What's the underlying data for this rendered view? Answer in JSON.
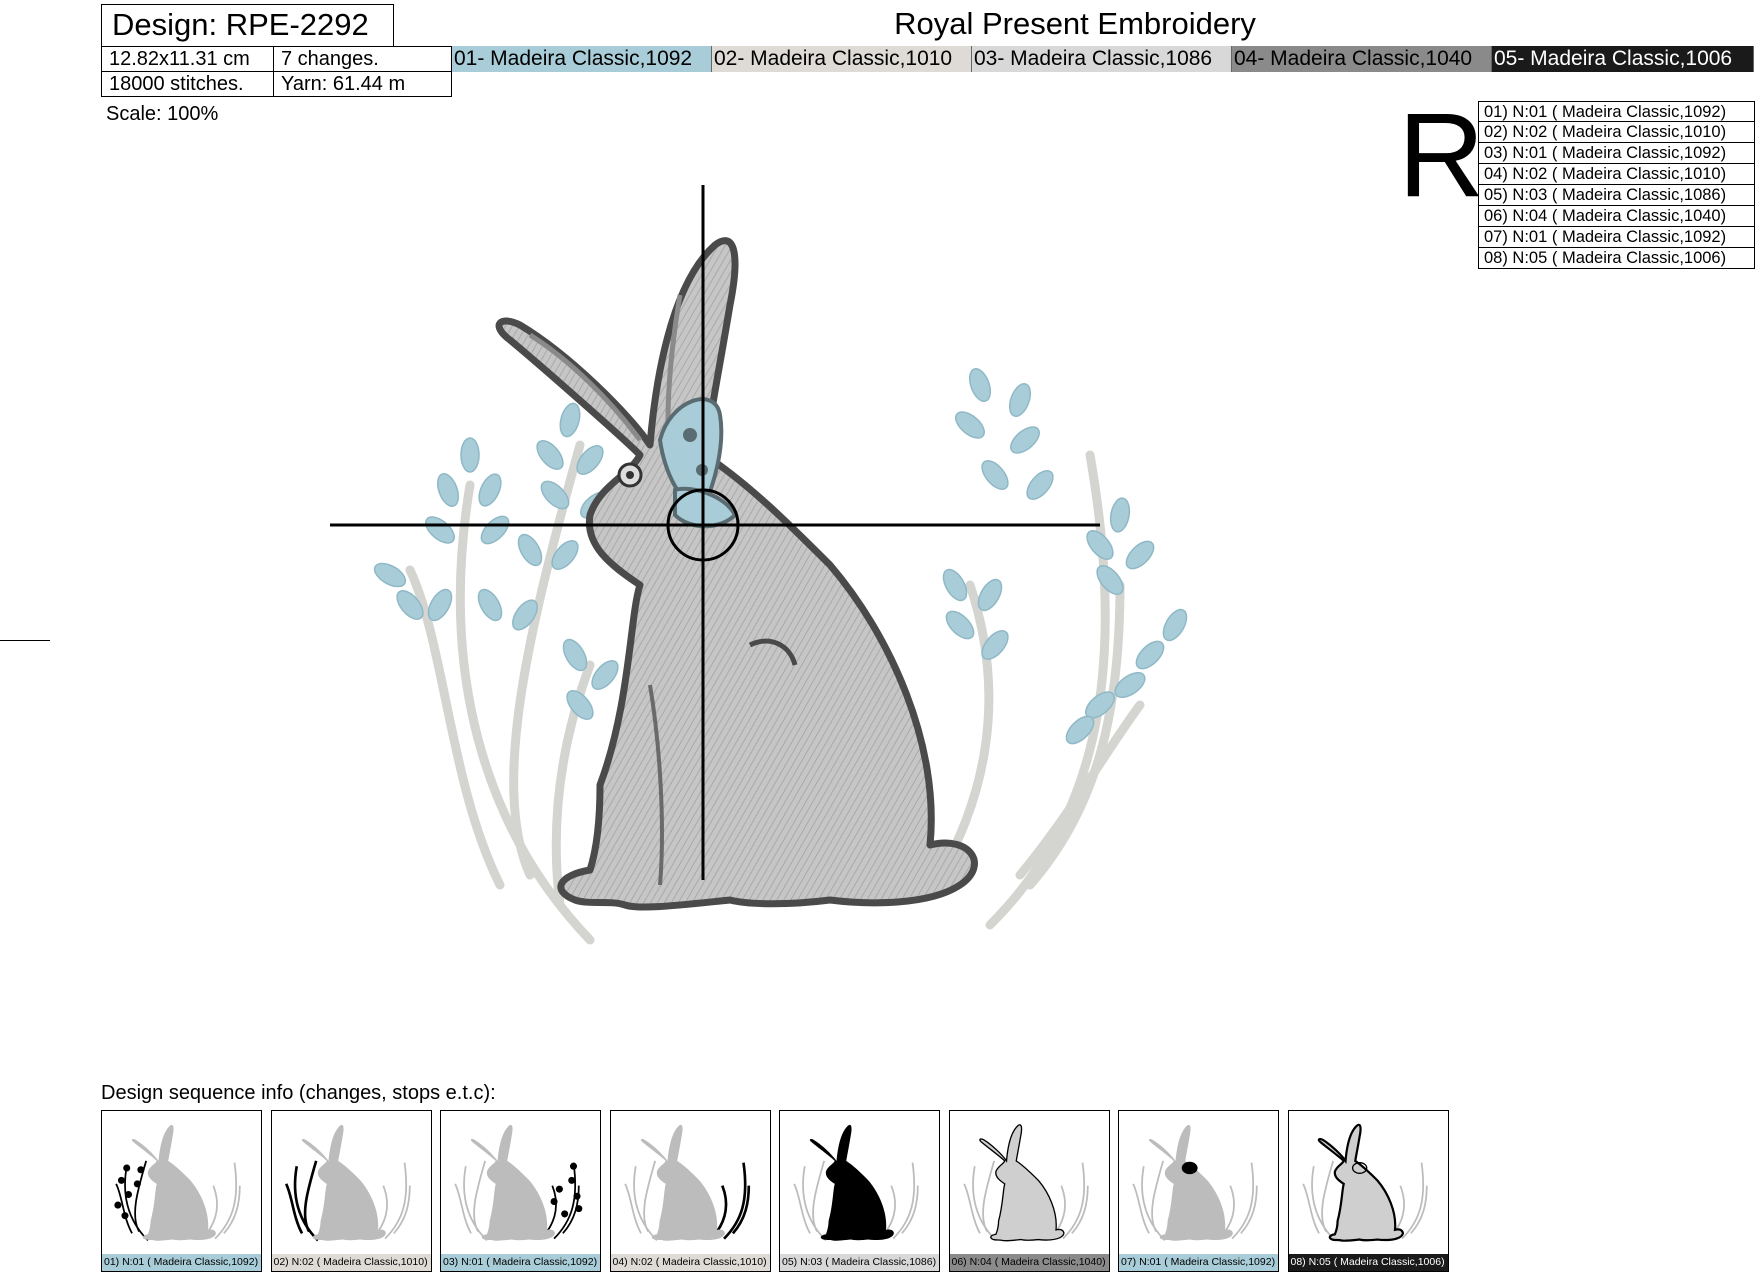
{
  "header": {
    "design_title": "Design: RPE-2292",
    "brand": "Royal Present Embroidery",
    "size": "12.82x11.31 cm",
    "changes": "7 changes.",
    "stitches": "18000 stitches.",
    "yarn": "Yarn: 61.44 m",
    "scale": "Scale: 100%"
  },
  "palette": [
    {
      "label": "01- Madeira Classic,1092",
      "bg": "#a9cdd8",
      "fg": "#000000"
    },
    {
      "label": "02- Madeira Classic,1010",
      "bg": "#dedbd6",
      "fg": "#000000"
    },
    {
      "label": "03- Madeira Classic,1086",
      "bg": "#d8d8d8",
      "fg": "#000000"
    },
    {
      "label": "04- Madeira Classic,1040",
      "bg": "#8a8a8a",
      "fg": "#000000"
    },
    {
      "label": "05- Madeira Classic,1006",
      "bg": "#1a1a1a",
      "fg": "#ffffff"
    }
  ],
  "big_letter": "R",
  "sequence_list": [
    "01) N:01 ( Madeira Classic,1092)",
    "02) N:02 ( Madeira Classic,1010)",
    "03) N:01 ( Madeira Classic,1092)",
    "04) N:02 ( Madeira Classic,1010)",
    "05) N:03 ( Madeira Classic,1086)",
    "06) N:04 ( Madeira Classic,1040)",
    "07) N:01 ( Madeira Classic,1092)",
    "08) N:05 ( Madeira Classic,1006)"
  ],
  "sequence_header": "Design sequence info (changes, stops e.t.c):",
  "thumbnails": [
    {
      "caption": "01) N:01 ( Madeira Classic,1092)",
      "cap_bg": "#a9cdd8",
      "cap_fg": "#000000",
      "highlight": "left-wreath"
    },
    {
      "caption": "02) N:02 ( Madeira Classic,1010)",
      "cap_bg": "#dedbd6",
      "cap_fg": "#000000",
      "highlight": "left-stem"
    },
    {
      "caption": "03) N:01 ( Madeira Classic,1092)",
      "cap_bg": "#a9cdd8",
      "cap_fg": "#000000",
      "highlight": "right-wreath"
    },
    {
      "caption": "04) N:02 ( Madeira Classic,1010)",
      "cap_bg": "#dedbd6",
      "cap_fg": "#000000",
      "highlight": "right-stem"
    },
    {
      "caption": "05) N:03 ( Madeira Classic,1086)",
      "cap_bg": "#d8d8d8",
      "cap_fg": "#000000",
      "highlight": "rabbit-fill"
    },
    {
      "caption": "06) N:04 ( Madeira Classic,1040)",
      "cap_bg": "#8a8a8a",
      "cap_fg": "#000000",
      "highlight": "rabbit-shading"
    },
    {
      "caption": "07) N:01 ( Madeira Classic,1092)",
      "cap_bg": "#a9cdd8",
      "cap_fg": "#000000",
      "highlight": "bow"
    },
    {
      "caption": "08) N:05 ( Madeira Classic,1006)",
      "cap_bg": "#1a1a1a",
      "cap_fg": "#ffffff",
      "highlight": "outline"
    }
  ]
}
